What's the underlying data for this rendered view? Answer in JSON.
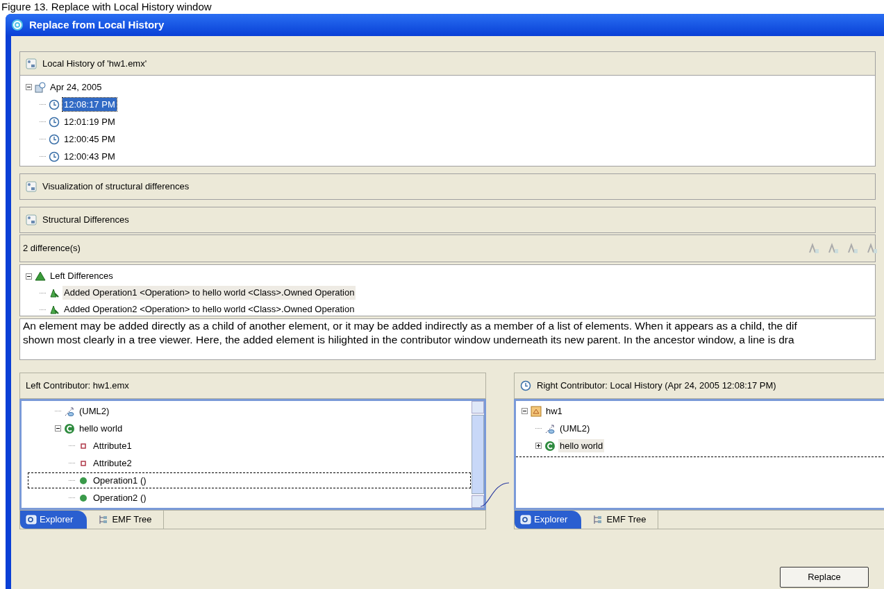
{
  "caption": "Figure 13. Replace with Local History window",
  "window": {
    "title": "Replace from Local History"
  },
  "history": {
    "title": "Local History of 'hw1.emx'",
    "tree": [
      {
        "kind": "date",
        "label": "Apr 24, 2005",
        "expanded": true,
        "children": [
          {
            "kind": "time",
            "label": "12:08:17 PM",
            "selected": true
          },
          {
            "kind": "time",
            "label": "12:01:19 PM",
            "selected": false
          },
          {
            "kind": "time",
            "label": "12:00:45 PM",
            "selected": false
          },
          {
            "kind": "time",
            "label": "12:00:43 PM",
            "selected": false
          }
        ]
      }
    ]
  },
  "sections": [
    {
      "title": "Visualization of structural differences"
    },
    {
      "title": "Structural Differences"
    }
  ],
  "differences": {
    "count": "2 difference(s)",
    "tree": [
      {
        "kind": "group",
        "label": "Left Differences",
        "expanded": true,
        "children": [
          {
            "kind": "added",
            "label": "Added Operation1 <Operation> to hello world <Class>.Owned Operation",
            "selected": true
          },
          {
            "kind": "added",
            "label": "Added Operation2 <Operation> to hello world <Class>.Owned Operation",
            "selected": false
          }
        ]
      }
    ]
  },
  "description": [
    "An element may be added directly as a child of another element, or it may be added indirectly as a member of a list of elements. When it appears as a child, the dif",
    "shown most clearly in a tree viewer. Here, the added element is hilighted in the contributor window underneath its new parent. In the ancestor window, a line is dra"
  ],
  "left_contributor": {
    "title": "Left Contributor: hw1.emx",
    "tree": [
      {
        "kind": "uml",
        "label": "(UML2)"
      },
      {
        "kind": "class",
        "label": "hello world",
        "expanded": true,
        "children": [
          {
            "kind": "attribute",
            "label": "Attribute1",
            "highlighted": false
          },
          {
            "kind": "attribute",
            "label": "Attribute2",
            "highlighted": false
          },
          {
            "kind": "operation",
            "label": "Operation1 ()",
            "highlighted": true
          },
          {
            "kind": "operation",
            "label": "Operation2 ()",
            "highlighted": false
          }
        ]
      }
    ],
    "tabs": [
      {
        "label": "Explorer",
        "selected": true
      },
      {
        "label": "EMF Tree",
        "selected": false
      }
    ]
  },
  "right_contributor": {
    "title": "Right Contributor: Local History (Apr 24, 2005 12:08:17 PM)",
    "insertion_marker": true,
    "tree": [
      {
        "kind": "model",
        "label": "hw1",
        "expanded": true,
        "children": [
          {
            "kind": "uml",
            "label": "(UML2)"
          },
          {
            "kind": "class",
            "label": "hello world",
            "expanded": false,
            "selected": true
          }
        ]
      }
    ],
    "tabs": [
      {
        "label": "Explorer",
        "selected": true
      },
      {
        "label": "EMF Tree",
        "selected": false
      }
    ]
  },
  "buttons": [
    "Replace"
  ]
}
